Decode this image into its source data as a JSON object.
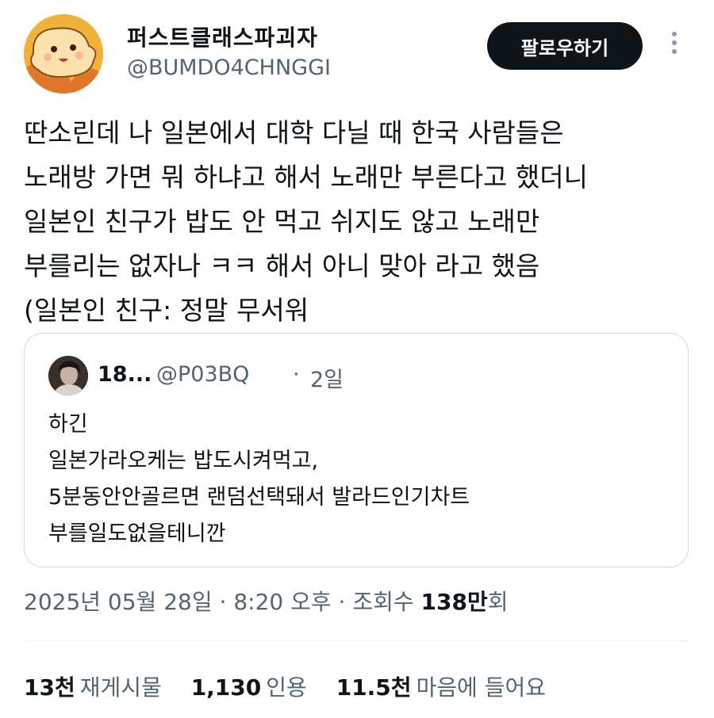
{
  "author": {
    "display_name": "퍼스트클래스파괴자",
    "handle": "@BUMDO4CHNGGI",
    "follow_label": "팔로우하기"
  },
  "tweet": {
    "lines": [
      "딴소린데 나 일본에서 대학 다닐 때 한국 사람들은",
      "노래방 가면 뭐 하냐고 해서 노래만 부른다고 했더니",
      "일본인 친구가 밥도 안 먹고 쉬지도 않고 노래만",
      "부를리는 없자나 ㅋㅋ 해서 아니 맞아 라고 했음",
      "(일본인 친구: 정말 무서워"
    ]
  },
  "quote": {
    "name": "18...",
    "handle": "@P03BQ",
    "separator": "·",
    "time": "2일",
    "lines": [
      "하긴",
      "일본가라오케는 밥도시켜먹고,",
      "5분동안안골르면 랜덤선택돼서 발라드인기차트",
      "부를일도없을테니깐"
    ]
  },
  "meta": {
    "date": "2025년 05월 28일",
    "sep1": "·",
    "time": "8:20 오후",
    "sep2": "·",
    "views_label": "조회수",
    "views_count": "138만",
    "views_suffix": "회"
  },
  "stats": [
    {
      "count": "13천",
      "label": "재게시물"
    },
    {
      "count": "1,130",
      "label": "인용"
    },
    {
      "count": "11.5천",
      "label": "마음에 들어요"
    }
  ],
  "colors": {
    "text": "#0f1419",
    "secondary": "#536471",
    "border": "#cfd9de",
    "button_bg": "#0f1419",
    "button_text": "#ffffff"
  }
}
